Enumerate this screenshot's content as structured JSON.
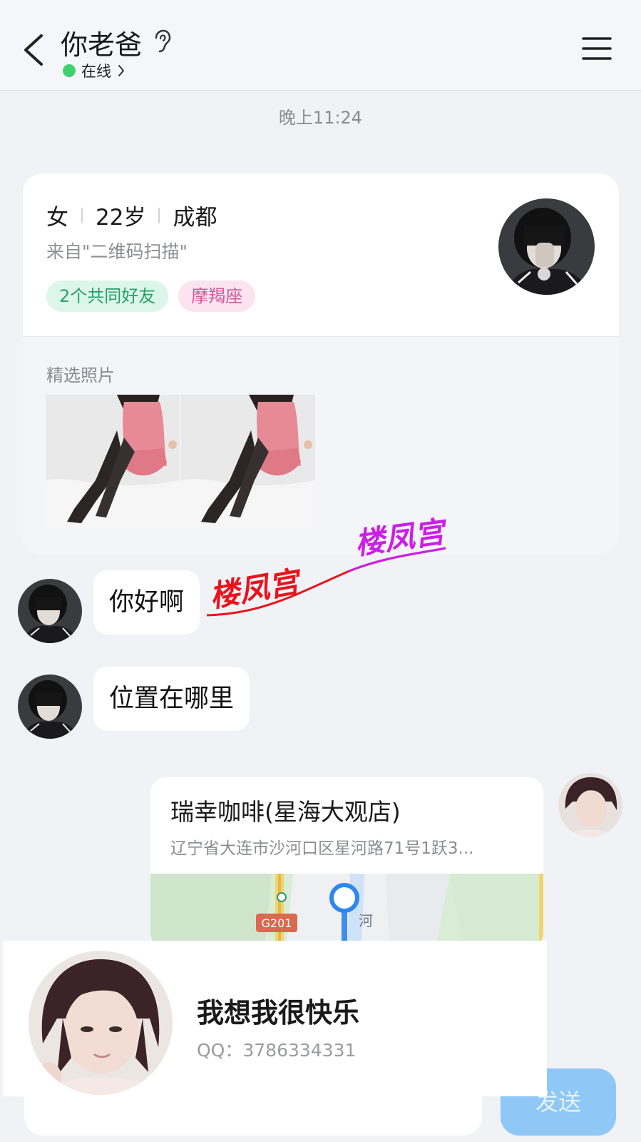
{
  "header": {
    "title": "你老爸",
    "status": "在线"
  },
  "chat": {
    "timestamp": "晚上11:24"
  },
  "profile": {
    "gender": "女",
    "age": "22岁",
    "city": "成都",
    "source": "来自\"二维码扫描\"",
    "tags": [
      "2个共同好友",
      "摩羯座"
    ],
    "photos_label": "精选照片"
  },
  "messages": [
    {
      "side": "left",
      "text": "你好啊"
    },
    {
      "side": "left",
      "text": "位置在哪里"
    }
  ],
  "location": {
    "name": "瑞幸咖啡(星海大观店)",
    "address": "辽宁省大连市沙河口区星河路71号1跃3...",
    "road_label": "G201",
    "map_text": "河"
  },
  "bottom_bar": {
    "send_label": "发送"
  },
  "contact_card": {
    "name": "我想我很快乐",
    "qq": "QQ：3786334331"
  },
  "watermark": {
    "text_1": "楼凤宫",
    "text_2": "楼凤宫"
  },
  "colors": {
    "online": "#3fd26f",
    "send_button": "#8fc7f6",
    "tag_friends_bg": "#dcf6e9",
    "tag_zodiac_bg": "#fbe3ef"
  }
}
